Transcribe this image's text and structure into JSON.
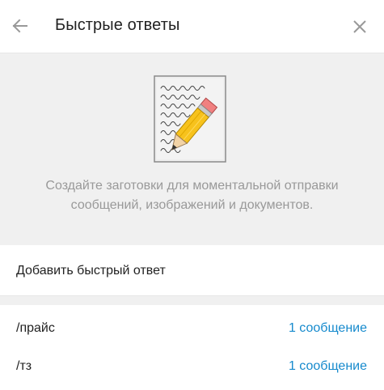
{
  "header": {
    "title": "Быстрые ответы",
    "back_icon": "arrow-left-icon",
    "close_icon": "close-icon"
  },
  "intro": {
    "illustration": "note-with-pencil-illustration",
    "text": "Создайте заготовки для моментальной отправки сообщений, изображений и документов."
  },
  "add_reply": {
    "label": "Добавить быстрый ответ"
  },
  "replies": [
    {
      "shortcut": "/прайс",
      "count": "1 сообщение"
    },
    {
      "shortcut": "/тз",
      "count": "1 сообщение"
    }
  ],
  "colors": {
    "accent": "#168acd",
    "muted_text": "#999999",
    "section_bg": "#f0f0f0"
  }
}
